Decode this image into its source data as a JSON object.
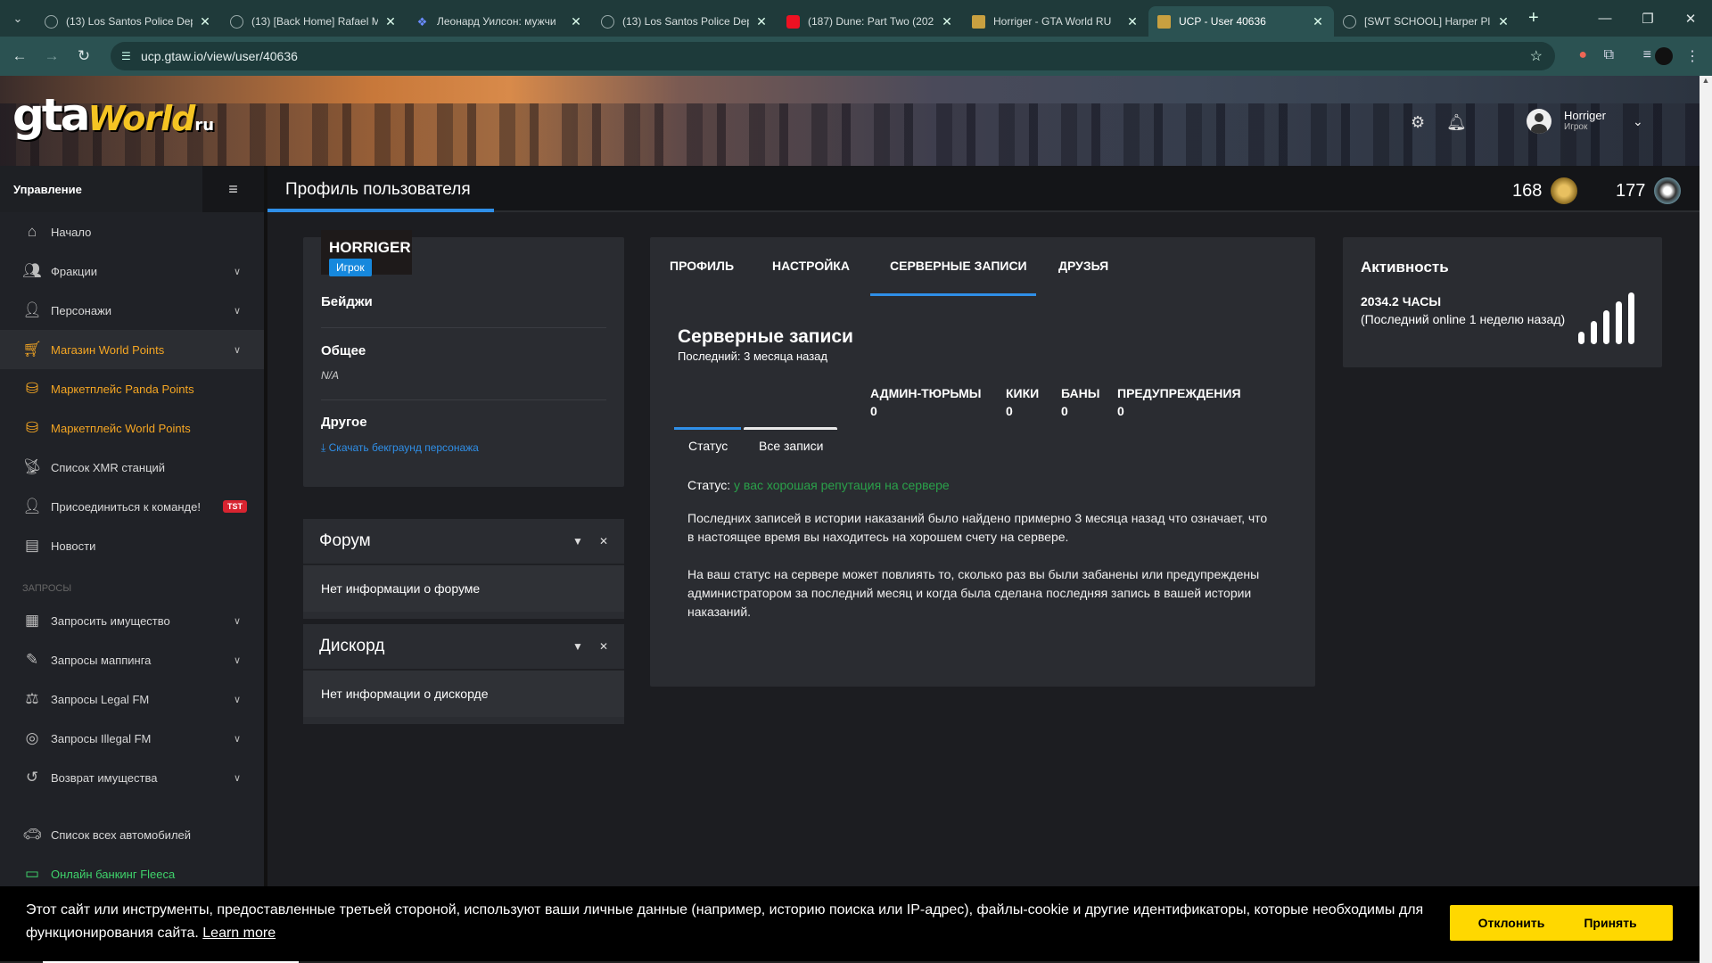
{
  "browser": {
    "tabs": [
      {
        "title": "(13) Los Santos Police Dep",
        "icon": "globe-icon"
      },
      {
        "title": "(13) [Back Home] Rafael M",
        "icon": "globe-icon"
      },
      {
        "title": "Леонард Уилсон: мужчи",
        "icon": "vk-icon"
      },
      {
        "title": "(13) Los Santos Police Dep",
        "icon": "globe-icon"
      },
      {
        "title": "(187) Dune: Part Two (202",
        "icon": "youtube-icon"
      },
      {
        "title": "Horriger - GTA World RU",
        "icon": "gta-icon"
      },
      {
        "title": "UCP - User 40636",
        "icon": "gta-icon",
        "active": true
      },
      {
        "title": "[SWT SCHOOL] Harper Pl",
        "icon": "globe-icon"
      }
    ],
    "url": "ucp.gtaw.io/view/user/40636"
  },
  "header": {
    "logo_main": "gta",
    "logo_world": "World",
    "logo_ru": "ru",
    "user_name": "Horriger",
    "user_role": "Игрок"
  },
  "sidebar": {
    "title": "Управление",
    "items": [
      {
        "label": "Начало",
        "icon": "home-icon"
      },
      {
        "label": "Фракции",
        "icon": "users-icon"
      },
      {
        "label": "Персонажи",
        "icon": "user-icon"
      },
      {
        "label": "Магазин World Points",
        "icon": "cart-icon"
      },
      {
        "label": "Маркетплейс Panda Points",
        "icon": "coins-icon"
      },
      {
        "label": "Маркетплейс World Points",
        "icon": "coins-icon"
      },
      {
        "label": "Список XMR станций",
        "icon": "antenna-icon"
      },
      {
        "label": "Присоединиться к команде!",
        "icon": "user-tie-icon",
        "badge": "TST"
      },
      {
        "label": "Новости",
        "icon": "newspaper-icon"
      }
    ],
    "section_requests": "ЗАПРОСЫ",
    "request_items": [
      {
        "label": "Запросить имущество",
        "icon": "building-icon"
      },
      {
        "label": "Запросы маппинга",
        "icon": "brush-icon"
      },
      {
        "label": "Запросы Legal FM",
        "icon": "scale-icon"
      },
      {
        "label": "Запросы Illegal FM",
        "icon": "mask-icon"
      },
      {
        "label": "Возврат имущества",
        "icon": "undo-icon"
      }
    ],
    "extra_items": [
      {
        "label": "Список всех автомобилей",
        "icon": "car-icon"
      },
      {
        "label": "Онлайн банкинг Fleeca",
        "icon": "money-icon"
      }
    ]
  },
  "page": {
    "title": "Профиль пользователя",
    "points_1": "168",
    "points_2": "177"
  },
  "profile": {
    "name": "HORRIGER",
    "role": "Игрок",
    "badges_label": "Бейджи",
    "general_label": "Общее",
    "general_value": "N/A",
    "other_label": "Другое",
    "download_link": "Скачать бекграунд персонажа"
  },
  "forum": {
    "title": "Форум",
    "body": "Нет информации о форуме"
  },
  "discord": {
    "title": "Дискорд",
    "body": "Нет информации о дискорде"
  },
  "records": {
    "tabs": [
      "ПРОФИЛЬ",
      "НАСТРОЙКА",
      "СЕРВЕРНЫЕ ЗАПИСИ",
      "ДРУЗЬЯ"
    ],
    "title": "Серверные записи",
    "subtitle": "Последний: 3 месяца назад",
    "stats": [
      {
        "label": "АДМИН-ТЮРЬМЫ",
        "value": "0"
      },
      {
        "label": "КИКИ",
        "value": "0"
      },
      {
        "label": "БАНЫ",
        "value": "0"
      },
      {
        "label": "ПРЕДУПРЕЖДЕНИЯ",
        "value": "0"
      }
    ],
    "subtabs": [
      "Статус",
      "Все записи"
    ],
    "status_label": "Статус:",
    "status_value": "у вас хорошая репутация на сервере",
    "para1": "Последних записей в истории наказаний было найдено примерно 3 месяца назад что означает, что в настоящее время вы находитесь на хорошем счету на сервере.",
    "para2": "На ваш статус на сервере может повлиять то, сколько раз вы были забанены или предупреждены администратором за последний месяц и когда была сделана последняя запись в вашей истории наказаний."
  },
  "activity": {
    "title": "Активность",
    "hours": "2034.2 ЧАСЫ",
    "last_online": "(Последний online 1 неделю назад)"
  },
  "cookie": {
    "text": "Этот сайт или инструменты, предоставленные третьей стороной, используют ваши личные данные (например, историю поиска или IP-адрес), файлы-cookie и другие идентификаторы, которые необходимы для функционирования сайта.",
    "learn_more": "Learn more",
    "decline": "Отклонить",
    "accept": "Принять"
  }
}
